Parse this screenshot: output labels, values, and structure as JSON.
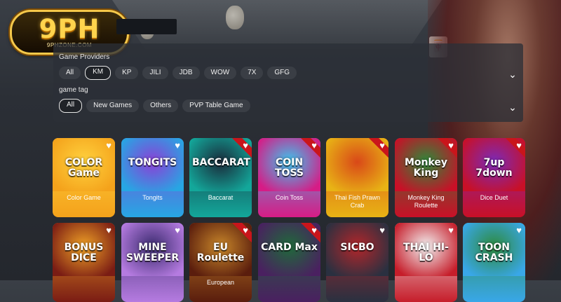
{
  "logo": {
    "text": "9PH",
    "sub": "9PHZONE.COM"
  },
  "providers": {
    "title": "Game Providers",
    "items": [
      "All",
      "KM",
      "KP",
      "JILI",
      "JDB",
      "WOW",
      "7X",
      "GFG"
    ],
    "active": "KM"
  },
  "tags": {
    "title": "game tag",
    "items": [
      "All",
      "New Games",
      "Others",
      "PVP Table Game"
    ],
    "active": "All"
  },
  "icons": {
    "favorite": "heart-icon",
    "expand": "chevron-down-icon"
  },
  "games_row1": [
    {
      "name": "Color Game",
      "art": "COLOR Game",
      "bg": "#f4a21b",
      "bg2": "#ffd23e",
      "ribbon": false
    },
    {
      "name": "Tongits",
      "art": "TONGITS",
      "bg": "#27a6e3",
      "bg2": "#8c3fd6",
      "ribbon": false
    },
    {
      "name": "Baccarat",
      "art": "BACCARAT",
      "bg": "#13a79a",
      "bg2": "#1a2a3a",
      "ribbon": true
    },
    {
      "name": "Coin Toss",
      "art": "COIN TOSS",
      "bg": "#d61c86",
      "bg2": "#3ac6ee",
      "ribbon": true
    },
    {
      "name": "Thai Fish Prawn Crab",
      "art": "",
      "bg": "#e8b315",
      "bg2": "#d94818",
      "ribbon": true
    },
    {
      "name": "Monkey King Roulette",
      "art": "Monkey King",
      "bg": "#c81027",
      "bg2": "#2c8a3a",
      "ribbon": true
    },
    {
      "name": "Dice Duet",
      "art": "7up 7down",
      "bg": "#c81027",
      "bg2": "#7b2ab9",
      "ribbon": true
    }
  ],
  "games_row2": [
    {
      "name": "",
      "art": "BONUS DICE",
      "bg": "#7a1c14",
      "bg2": "#f0a226",
      "ribbon": false
    },
    {
      "name": "",
      "art": "MINE SWEEPER",
      "bg": "#b57be0",
      "bg2": "#3a2b6e",
      "ribbon": false
    },
    {
      "name": "European",
      "art": "EU Roulette",
      "bg": "#5a1d0d",
      "bg2": "#c8872a",
      "ribbon": true
    },
    {
      "name": "",
      "art": "CARD Max",
      "bg": "#4a2060",
      "bg2": "#1f6a3a",
      "ribbon": true
    },
    {
      "name": "",
      "art": "SICBO",
      "bg": "#2a3040",
      "bg2": "#b3262a",
      "ribbon": false
    },
    {
      "name": "",
      "art": "THAI HI-LO",
      "bg": "#c61d2a",
      "bg2": "#f2f2f2",
      "ribbon": false
    },
    {
      "name": "",
      "art": "TOON CRASH",
      "bg": "#39a7e8",
      "bg2": "#2e8a3c",
      "ribbon": false
    }
  ],
  "colors": {
    "accent": "#ffd44d",
    "ribbon": "#c9151b",
    "panel": "#2c3037"
  }
}
